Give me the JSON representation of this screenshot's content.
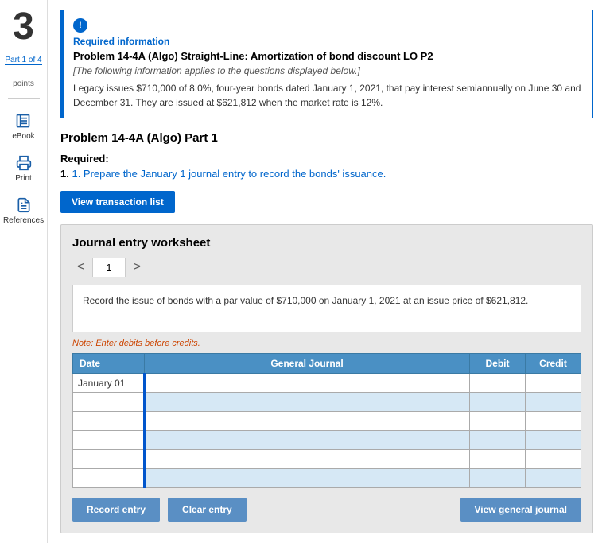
{
  "sidebar": {
    "page_number": "3",
    "part_label": "Part 1 of 4",
    "points_label": "points",
    "items": [
      {
        "id": "ebook",
        "label": "eBook",
        "icon": "book-icon"
      },
      {
        "id": "print",
        "label": "Print",
        "icon": "print-icon"
      },
      {
        "id": "references",
        "label": "References",
        "icon": "references-icon"
      }
    ]
  },
  "info_box": {
    "required_label": "Required information",
    "problem_title": "Problem 14-4A (Algo) Straight-Line: Amortization of bond discount LO P2",
    "italic_text": "[The following information applies to the questions displayed below.]",
    "body_text": "Legacy issues $710,000 of 8.0%, four-year bonds dated January 1, 2021, that pay interest semiannually on June 30 and December 31. They are issued at $621,812 when the market rate is 12%."
  },
  "part_section": {
    "title": "Problem 14-4A (Algo) Part 1",
    "required_label": "Required:",
    "required_text": "1. Prepare the January 1 journal entry to record the bonds' issuance.",
    "view_transaction_btn": "View transaction list"
  },
  "worksheet": {
    "title": "Journal entry worksheet",
    "tab_label": "1",
    "description": "Record the issue of bonds with a par value of $710,000 on January 1, 2021 at an issue price of $621,812.",
    "note": "Note: Enter debits before credits.",
    "table": {
      "headers": [
        "Date",
        "General Journal",
        "Debit",
        "Credit"
      ],
      "rows": [
        {
          "date": "January 01",
          "journal": "",
          "debit": "",
          "credit": ""
        },
        {
          "date": "",
          "journal": "",
          "debit": "",
          "credit": ""
        },
        {
          "date": "",
          "journal": "",
          "debit": "",
          "credit": ""
        },
        {
          "date": "",
          "journal": "",
          "debit": "",
          "credit": ""
        },
        {
          "date": "",
          "journal": "",
          "debit": "",
          "credit": ""
        },
        {
          "date": "",
          "journal": "",
          "debit": "",
          "credit": ""
        }
      ]
    }
  },
  "buttons": {
    "record_entry": "Record entry",
    "clear_entry": "Clear entry",
    "view_general_journal": "View general journal"
  }
}
